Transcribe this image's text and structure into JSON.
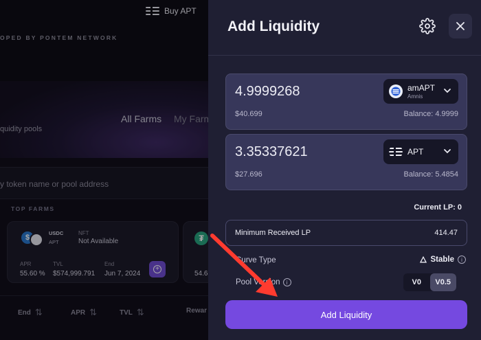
{
  "background": {
    "buy_label": "Buy APT",
    "tagline": "OPED BY PONTEM NETWORK",
    "hero_subtitle": "quidity pools",
    "tabs": [
      "All Farms",
      "My Farm"
    ],
    "search_placeholder": "y token name or pool address",
    "section_label": "TOP FARMS",
    "farm_card": {
      "pair_top": "USDC",
      "pair_bottom": "APT",
      "nft_label": "NFT",
      "nft_value": "Not Available",
      "apr_label": "APR",
      "apr_value": "55.60 %",
      "tvl_label": "TVL",
      "tvl_value": "$574,999.791",
      "end_label": "End",
      "end_value": "Jun 7, 2024"
    },
    "farm_card2": {
      "apr_value": "54.6"
    },
    "table_headers": [
      "End",
      "APR",
      "TVL",
      "Rewar"
    ]
  },
  "modal": {
    "title": "Add Liquidity",
    "inputs": [
      {
        "amount": "4.9999268",
        "usd": "$40.699",
        "balance": "Balance: 4.9999",
        "token_symbol": "amAPT",
        "token_subtitle": "Amnis",
        "token_icon": "amnis-icon"
      },
      {
        "amount": "3.35337621",
        "usd": "$27.696",
        "balance": "Balance: 5.4854",
        "token_symbol": "APT",
        "token_subtitle": "",
        "token_icon": "aptos-icon"
      }
    ],
    "current_lp": "Current LP: 0",
    "min_received_label": "Minimum Received LP",
    "min_received_value": "414.47",
    "curve_type_label": "Curve Type",
    "curve_type_value": "Stable",
    "pool_version_label": "Pool Version",
    "versions": [
      "V0",
      "V0.5"
    ],
    "selected_version": "V0.5",
    "submit_label": "Add Liquidity"
  },
  "colors": {
    "accent": "#7549e0",
    "panel_bg": "#1f1f33",
    "input_bg": "#37375a",
    "annotation_arrow": "#ff3b2f"
  }
}
